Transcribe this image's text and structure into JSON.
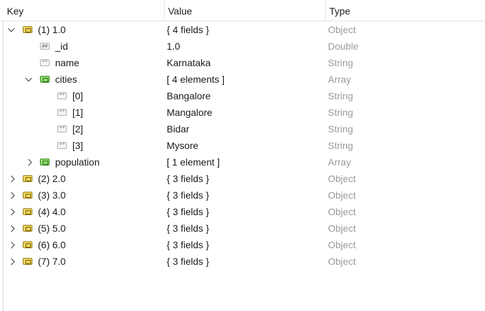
{
  "columns": {
    "key": "Key",
    "value": "Value",
    "type": "Type"
  },
  "rows": [
    {
      "key": "(1) 1.0",
      "value": "{ 4 fields }",
      "type": "Object",
      "icon": "object-icon",
      "expand": "expanded"
    },
    {
      "key": "_id",
      "value": "1.0",
      "type": "Double",
      "icon": "number-icon",
      "expand": "none"
    },
    {
      "key": "name",
      "value": "Karnataka",
      "type": "String",
      "icon": "string-icon",
      "expand": "none"
    },
    {
      "key": "cities",
      "value": "[ 4 elements ]",
      "type": "Array",
      "icon": "array-icon",
      "expand": "expanded"
    },
    {
      "key": "[0]",
      "value": "Bangalore",
      "type": "String",
      "icon": "string-icon",
      "expand": "none"
    },
    {
      "key": "[1]",
      "value": "Mangalore",
      "type": "String",
      "icon": "string-icon",
      "expand": "none"
    },
    {
      "key": "[2]",
      "value": "Bidar",
      "type": "String",
      "icon": "string-icon",
      "expand": "none"
    },
    {
      "key": "[3]",
      "value": "Mysore",
      "type": "String",
      "icon": "string-icon",
      "expand": "none"
    },
    {
      "key": "population",
      "value": "[ 1 element ]",
      "type": "Array",
      "icon": "array-icon",
      "expand": "collapsed"
    },
    {
      "key": "(2) 2.0",
      "value": "{ 3 fields }",
      "type": "Object",
      "icon": "object-icon",
      "expand": "collapsed"
    },
    {
      "key": "(3) 3.0",
      "value": "{ 3 fields }",
      "type": "Object",
      "icon": "object-icon",
      "expand": "collapsed"
    },
    {
      "key": "(4) 4.0",
      "value": "{ 3 fields }",
      "type": "Object",
      "icon": "object-icon",
      "expand": "collapsed"
    },
    {
      "key": "(5) 5.0",
      "value": "{ 3 fields }",
      "type": "Object",
      "icon": "object-icon",
      "expand": "collapsed"
    },
    {
      "key": "(6) 6.0",
      "value": "{ 3 fields }",
      "type": "Object",
      "icon": "object-icon",
      "expand": "collapsed"
    },
    {
      "key": "(7) 7.0",
      "value": "{ 3 fields }",
      "type": "Object",
      "icon": "object-icon",
      "expand": "collapsed"
    }
  ],
  "colors": {
    "type_text": "#9a9a9a",
    "object_icon": "#f2d45a",
    "array_icon": "#8fdc6e",
    "grid_line": "#e4e4e4"
  }
}
